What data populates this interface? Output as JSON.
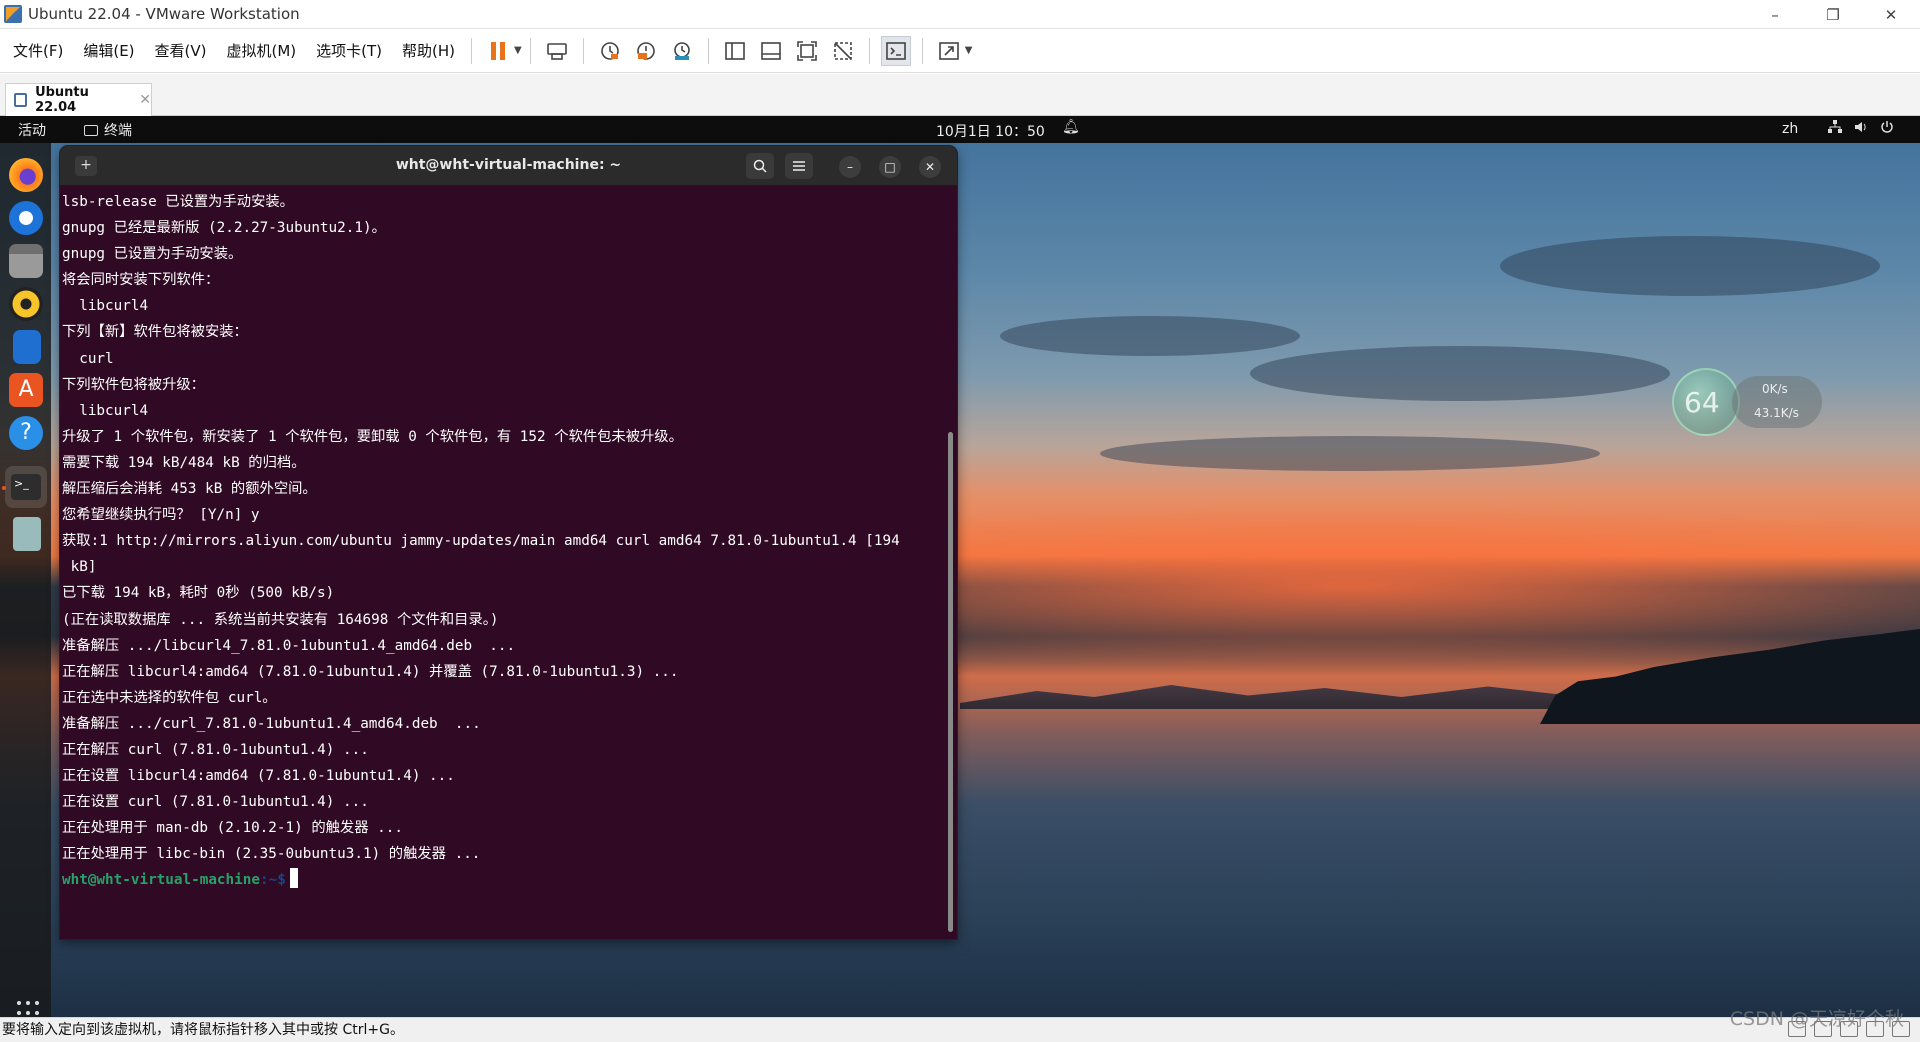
{
  "vm": {
    "window_title": "Ubuntu 22.04 - VMware Workstation",
    "menu": [
      "文件(F)",
      "编辑(E)",
      "查看(V)",
      "虚拟机(M)",
      "选项卡(T)",
      "帮助(H)"
    ],
    "tab_label": "Ubuntu 22.04",
    "status_text": "要将输入定向到该虚拟机，请将鼠标指针移入其中或按 Ctrl+G。",
    "watermark": "CSDN @天凉好个秋"
  },
  "ubuntu": {
    "activities": "活动",
    "app_indicator": "终端",
    "clock": "10月1日  10：50",
    "lang": "zh"
  },
  "terminal": {
    "title": "wht@wht-virtual-machine: ~",
    "lines": [
      "lsb-release 已设置为手动安装。",
      "gnupg 已经是最新版 (2.2.27-3ubuntu2.1)。",
      "gnupg 已设置为手动安装。",
      "将会同时安装下列软件：",
      "  libcurl4",
      "下列【新】软件包将被安装：",
      "  curl",
      "下列软件包将被升级：",
      "  libcurl4",
      "升级了 1 个软件包，新安装了 1 个软件包，要卸载 0 个软件包，有 152 个软件包未被升级。",
      "需要下载 194 kB/484 kB 的归档。",
      "解压缩后会消耗 453 kB 的额外空间。",
      "您希望继续执行吗？ [Y/n] y",
      "获取:1 http://mirrors.aliyun.com/ubuntu jammy-updates/main amd64 curl amd64 7.81.0-1ubuntu1.4 [194",
      " kB]",
      "已下载 194 kB，耗时 0秒 (500 kB/s)",
      "(正在读取数据库 ... 系统当前共安装有 164698 个文件和目录。)",
      "准备解压 .../libcurl4_7.81.0-1ubuntu1.4_amd64.deb  ...",
      "正在解压 libcurl4:amd64 (7.81.0-1ubuntu1.4) 并覆盖 (7.81.0-1ubuntu1.3) ...",
      "正在选中未选择的软件包 curl。",
      "准备解压 .../curl_7.81.0-1ubuntu1.4_amd64.deb  ...",
      "正在解压 curl (7.81.0-1ubuntu1.4) ...",
      "正在设置 libcurl4:amd64 (7.81.0-1ubuntu1.4) ...",
      "正在设置 curl (7.81.0-1ubuntu1.4) ...",
      "正在处理用于 man-db (2.10.2-1) 的触发器 ...",
      "正在处理用于 libc-bin (2.35-0ubuntu3.1) 的触发器 ..."
    ],
    "prompt_user": "wht@wht-virtual-machine",
    "prompt_path": ":~$"
  },
  "net_widget": {
    "percent": "64",
    "up": "0K/s",
    "down": "43.1K/s"
  },
  "icons": {
    "dock": [
      "firefox-icon",
      "thunderbird-icon",
      "files-icon",
      "rhythmbox-icon",
      "writer-icon",
      "software-icon",
      "help-icon",
      "terminal-icon",
      "trash-icon",
      "app-grid-icon"
    ]
  }
}
